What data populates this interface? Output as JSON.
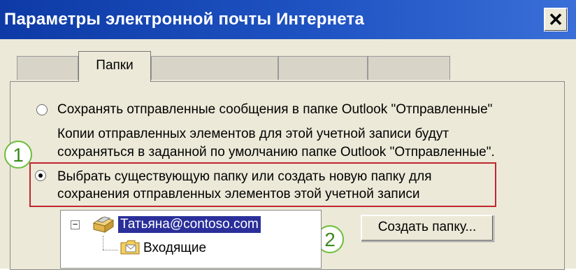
{
  "window": {
    "title": "Параметры электронной почты Интернета"
  },
  "close": {
    "label": "✕"
  },
  "tabs": {
    "active_label": "Папки"
  },
  "options": {
    "save_to_sent_label": "Сохранять отправленные сообщения в папке Outlook \"Отправленные\"",
    "save_to_sent_desc_line1": "Копии отправленных элементов для этой учетной записи будут",
    "save_to_sent_desc_line2": "сохраняться в заданной по умолчанию папке Outlook \"Отправленные\".",
    "choose_folder_line1": "Выбрать существующую папку или создать новую папку для",
    "choose_folder_line2": "сохранения отправленных элементов этой учетной записи"
  },
  "callouts": {
    "first": "1",
    "second": "2"
  },
  "tree": {
    "expander": "−",
    "account": "Татьяна@contoso.com",
    "inbox": "Входящие"
  },
  "buttons": {
    "create_folder": "Создать папку..."
  },
  "colors": {
    "title_bar": "#1f53c2",
    "highlight": "#c0272d",
    "callout": "#6cbd3a",
    "selection": "#2a2f9a"
  }
}
